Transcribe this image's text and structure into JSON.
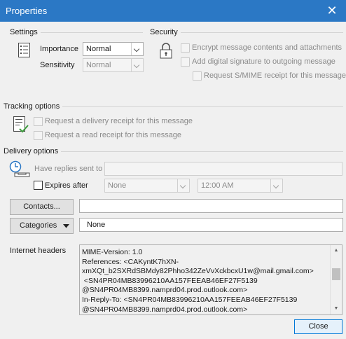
{
  "window": {
    "title": "Properties",
    "close_glyph": "✕"
  },
  "settings": {
    "heading": "Settings",
    "importance_label": "Importance",
    "importance_value": "Normal",
    "sensitivity_label": "Sensitivity",
    "sensitivity_value": "Normal",
    "icon": "document-settings-icon"
  },
  "security": {
    "heading": "Security",
    "icon": "lock-icon",
    "encrypt_label": "Encrypt message contents and attachments",
    "signature_label": "Add digital signature to outgoing message",
    "smime_label": "Request S/MIME receipt for this message"
  },
  "tracking": {
    "heading": "Tracking options",
    "icon": "checklist-icon",
    "delivery_receipt_label": "Request a delivery receipt for this message",
    "read_receipt_label": "Request a read receipt for this message"
  },
  "delivery": {
    "heading": "Delivery options",
    "icon": "clock-tray-icon",
    "replies_label": "Have replies sent to",
    "replies_value": "",
    "expires_label": "Expires after",
    "expires_date": "None",
    "expires_time": "12:00 AM"
  },
  "contacts": {
    "button_label": "Contacts...",
    "value": ""
  },
  "categories": {
    "button_label": "Categories",
    "value": "None"
  },
  "internet_headers": {
    "label": "Internet headers",
    "text": "MIME-Version: 1.0\nReferences: <CAKyntK7hXN-\nxmXQt_b2SXRdSBMdy82Phho342ZeVvXckbcxU1w@mail.gmail.com>\n <SN4PR04MB83996210AA157FEEAB46EF27F5139\n@SN4PR04MB8399.namprd04.prod.outlook.com>\nIn-Reply-To: <SN4PR04MB83996210AA157FEEAB46EF27F5139\n@SN4PR04MB8399.namprd04.prod.outlook.com>"
  },
  "close_button_label": "Close"
}
